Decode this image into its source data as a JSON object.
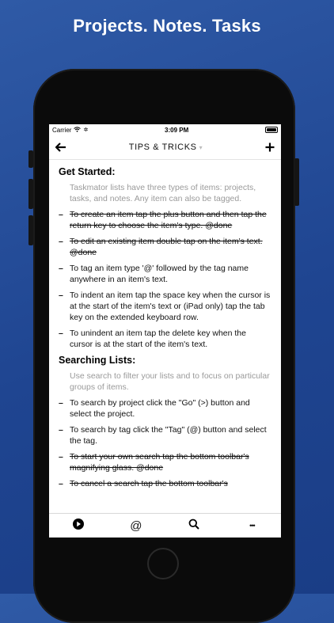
{
  "promo": {
    "headline": "Projects. Notes. Tasks"
  },
  "status": {
    "carrier": "Carrier",
    "time": "3:09 PM"
  },
  "nav": {
    "back_icon": "back-arrow",
    "title": "TIPS & TRICKS",
    "title_caret": "▾",
    "add_icon": "plus"
  },
  "sections": [
    {
      "heading": "Get Started:",
      "note": "Taskmator lists have three types of items: projects, tasks, and notes. Any item can also be tagged.",
      "tasks": [
        {
          "text": "To create an item tap the plus button and then tap the return key to choose the item's type. @done",
          "done": true
        },
        {
          "text": "To edit an existing item double tap on the item's text. @done",
          "done": true
        },
        {
          "text": "To tag an item type '@' followed by the tag name anywhere in an item's text.",
          "done": false
        },
        {
          "text": "To indent an item tap the space key when the cursor is at the start of the item's text or (iPad only) tap the tab key on the extended keyboard row.",
          "done": false
        },
        {
          "text": "To unindent an item tap the delete key when the cursor is at the start of the item's text.",
          "done": false
        }
      ]
    },
    {
      "heading": "Searching Lists:",
      "note": "Use search to filter your lists and to focus on particular groups of items.",
      "tasks": [
        {
          "text": "To search by project click the \"Go\" (>) button and select the project.",
          "done": false
        },
        {
          "text": "To search by tag click the \"Tag\" (@) button and select the tag.",
          "done": false
        },
        {
          "text": "To start your own search tap the bottom toolbar's magnifying glass. @done",
          "done": true
        },
        {
          "text": "To cancel a search tap the bottom toolbar's",
          "done": true
        }
      ]
    }
  ],
  "tabbar": {
    "go_icon": "play-circle",
    "tag_label": "@",
    "search_icon": "magnifier",
    "more_label": "•••"
  },
  "colors": {
    "background": "#2050a0",
    "note_gray": "#9a9a9a"
  }
}
